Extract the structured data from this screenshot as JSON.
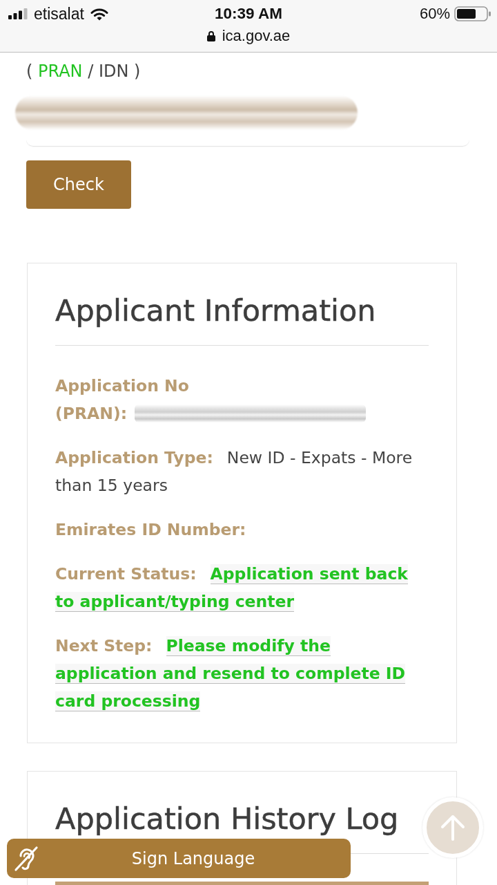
{
  "status_bar": {
    "carrier": "etisalat",
    "time": "10:39 AM",
    "battery": "60%",
    "url": "ica.gov.ae"
  },
  "search": {
    "id_type": {
      "prefix": "(",
      "options": [
        {
          "label": "PRAN",
          "selected": true
        },
        {
          "label": "IDN",
          "selected": false
        }
      ],
      "separator": "/",
      "suffix": ")"
    },
    "number_field": {
      "kind": "redacted"
    },
    "button": "Check"
  },
  "applicant_information": {
    "title": "Applicant Information",
    "fields": [
      {
        "label": "Application No (PRAN):",
        "kind": "redacted"
      },
      {
        "label": "Application Type:",
        "kind": "text",
        "value": "New ID - Expats - More than 15 years"
      },
      {
        "label": "Emirates ID Number:",
        "kind": "text"
      },
      {
        "label": "Current Status:",
        "kind": "status",
        "value": "Application sent back to applicant/typing center"
      },
      {
        "label": "Next Step:",
        "kind": "status",
        "value": "Please modify the application and resend to complete ID card processing"
      }
    ]
  },
  "application_history_log": {
    "title": "Application History Log"
  },
  "sign_language_button": {
    "label": "Sign Language"
  }
}
